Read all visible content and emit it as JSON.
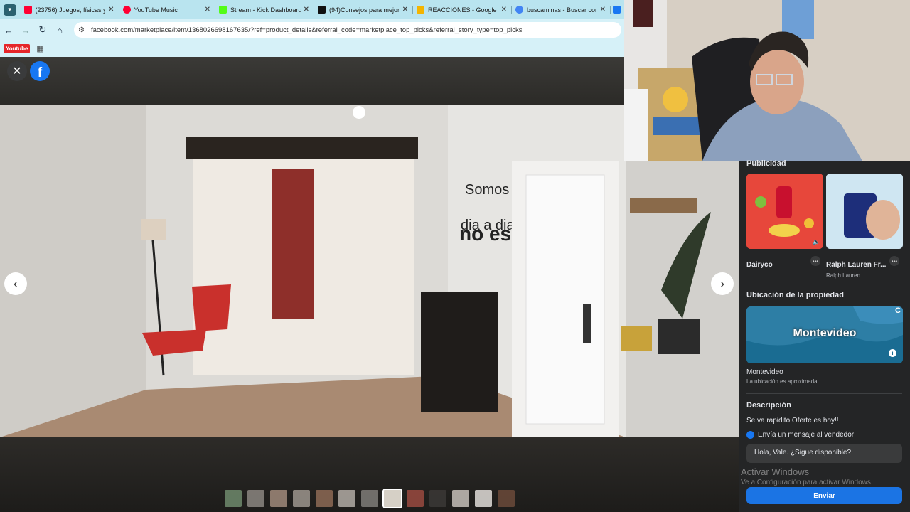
{
  "browser": {
    "tabs": [
      {
        "title": "(23756) Juegos, físicas y c",
        "favicon_color": "#ff0033",
        "favicon": "youtube-icon"
      },
      {
        "title": "YouTube Music",
        "favicon_color": "#ff0033",
        "favicon": "youtube-music-icon"
      },
      {
        "title": "Stream - Kick Dashboard",
        "favicon_color": "#53fc18",
        "favicon": "kick-icon"
      },
      {
        "title": "(94)Consejos para mejora",
        "favicon_color": "#111111",
        "favicon": "tiktok-icon"
      },
      {
        "title": "REACCIONES - Google Dr",
        "favicon_color": "#f4b400",
        "favicon": "google-drive-icon"
      },
      {
        "title": "buscaminas - Buscar con",
        "favicon_color": "#4285f4",
        "favicon": "google-icon"
      }
    ],
    "url": "facebook.com/marketplace/item/1368026698167635/?ref=product_details&referral_code=marketplace_top_picks&referral_story_type=top_picks",
    "bookmarks": [
      {
        "label": "Youtube"
      }
    ]
  },
  "viewer": {
    "thumbnail_count": 13,
    "selected_thumbnail": 8
  },
  "panel": {
    "ads_heading": "Publicidad",
    "ads": [
      {
        "name": "Dairyco",
        "sub": ""
      },
      {
        "name": "Ralph Lauren Fr...",
        "sub": "Ralph Lauren"
      }
    ],
    "location_heading": "Ubicación de la propiedad",
    "map_label": "Montevideo",
    "map_corner": "C",
    "location_name": "Montevideo",
    "location_note": "La ubicación es aproximada",
    "description_heading": "Descripción",
    "description_text": "Se va rapidito Oferte es hoy!!",
    "message_label": "Envía un mensaje al vendedor",
    "message_text": "Hola, Vale. ¿Sigue disponible?",
    "send_label": "Enviar"
  },
  "watermark": {
    "line1": "Activar Windows",
    "line2": "Ve a Configuración para activar Windows."
  }
}
